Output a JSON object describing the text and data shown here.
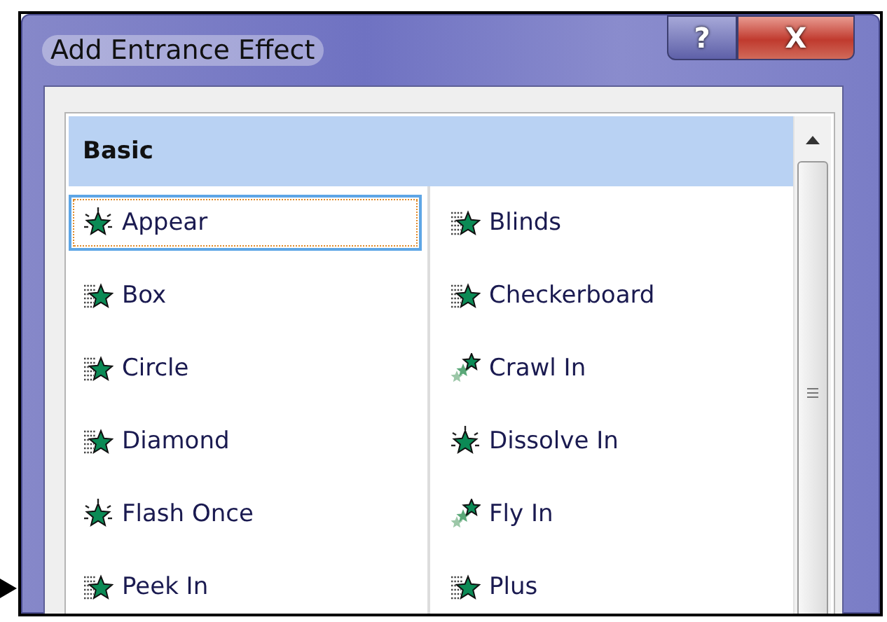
{
  "window": {
    "title": "Add Entrance Effect",
    "buttons": [
      {
        "kind": "help",
        "label": "?"
      },
      {
        "kind": "close",
        "label": "X"
      }
    ]
  },
  "groups": [
    {
      "title": "Basic",
      "effects": [
        {
          "label": "Appear",
          "kind": "sparkle",
          "selected": true
        },
        {
          "label": "Blinds",
          "kind": "wipe",
          "selected": false
        },
        {
          "label": "Box",
          "kind": "wipe",
          "selected": false
        },
        {
          "label": "Checkerboard",
          "kind": "wipe",
          "selected": false
        },
        {
          "label": "Circle",
          "kind": "wipe",
          "selected": false
        },
        {
          "label": "Crawl In",
          "kind": "fly",
          "selected": false
        },
        {
          "label": "Diamond",
          "kind": "wipe",
          "selected": false
        },
        {
          "label": "Dissolve In",
          "kind": "sparkle",
          "selected": false
        },
        {
          "label": "Flash Once",
          "kind": "sparkle",
          "selected": false
        },
        {
          "label": "Fly In",
          "kind": "fly",
          "selected": false
        },
        {
          "label": "Peek In",
          "kind": "wipe",
          "selected": false
        },
        {
          "label": "Plus",
          "kind": "wipe",
          "selected": false
        }
      ]
    }
  ]
}
